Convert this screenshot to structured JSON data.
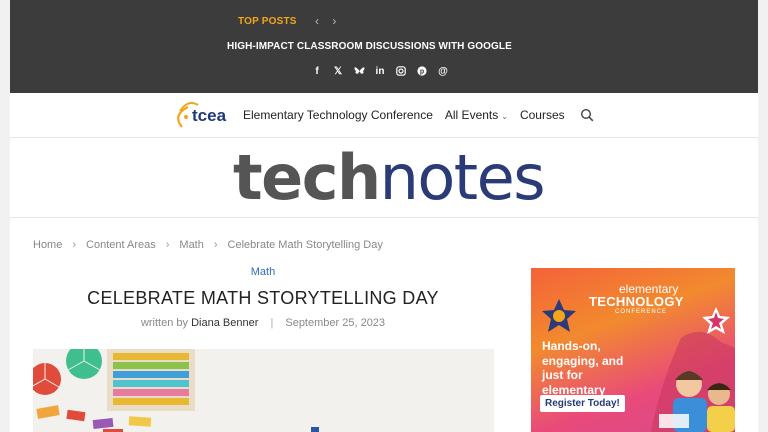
{
  "topbar": {
    "top_posts_label": "TOP POSTS",
    "headline": "HIGH-IMPACT CLASSROOM DISCUSSIONS WITH GOOGLE",
    "prev_glyph": "‹",
    "next_glyph": "›",
    "socials": [
      {
        "name": "facebook-icon",
        "glyph": "f"
      },
      {
        "name": "x-icon",
        "glyph": "𝕏"
      },
      {
        "name": "bluesky-icon",
        "glyph": "🦋"
      },
      {
        "name": "linkedin-icon",
        "glyph": "in"
      },
      {
        "name": "instagram-icon",
        "glyph": "◎"
      },
      {
        "name": "pinterest-icon",
        "glyph": "℗"
      },
      {
        "name": "threads-icon",
        "glyph": "@"
      }
    ]
  },
  "nav": {
    "logo_text": "tcea",
    "items": [
      "Elementary Technology Conference",
      "All Events",
      "Courses"
    ],
    "all_events_chevron": "⌄"
  },
  "masthead": {
    "brand_part1": "tech",
    "brand_part2": "notes"
  },
  "breadcrumb": [
    "Home",
    "Content Areas",
    "Math",
    "Celebrate Math Storytelling Day"
  ],
  "article": {
    "category": "Math",
    "title": "CELEBRATE MATH STORYTELLING DAY",
    "byline_prefix": "written by",
    "author": "Diana Benner",
    "date": "September 25, 2023"
  },
  "ad": {
    "kicker": "elementary",
    "title": "TECHNOLOGY",
    "subtitle": "CONFERENCE",
    "body": "Hands-on, engaging, and just for elementary educators!",
    "cta": "Register Today!"
  },
  "colors": {
    "topbar_bg": "#3c3c3c",
    "accent_orange": "#f4a51c",
    "brand_blue": "#2a3b78",
    "link_blue": "#2f6dbd"
  }
}
